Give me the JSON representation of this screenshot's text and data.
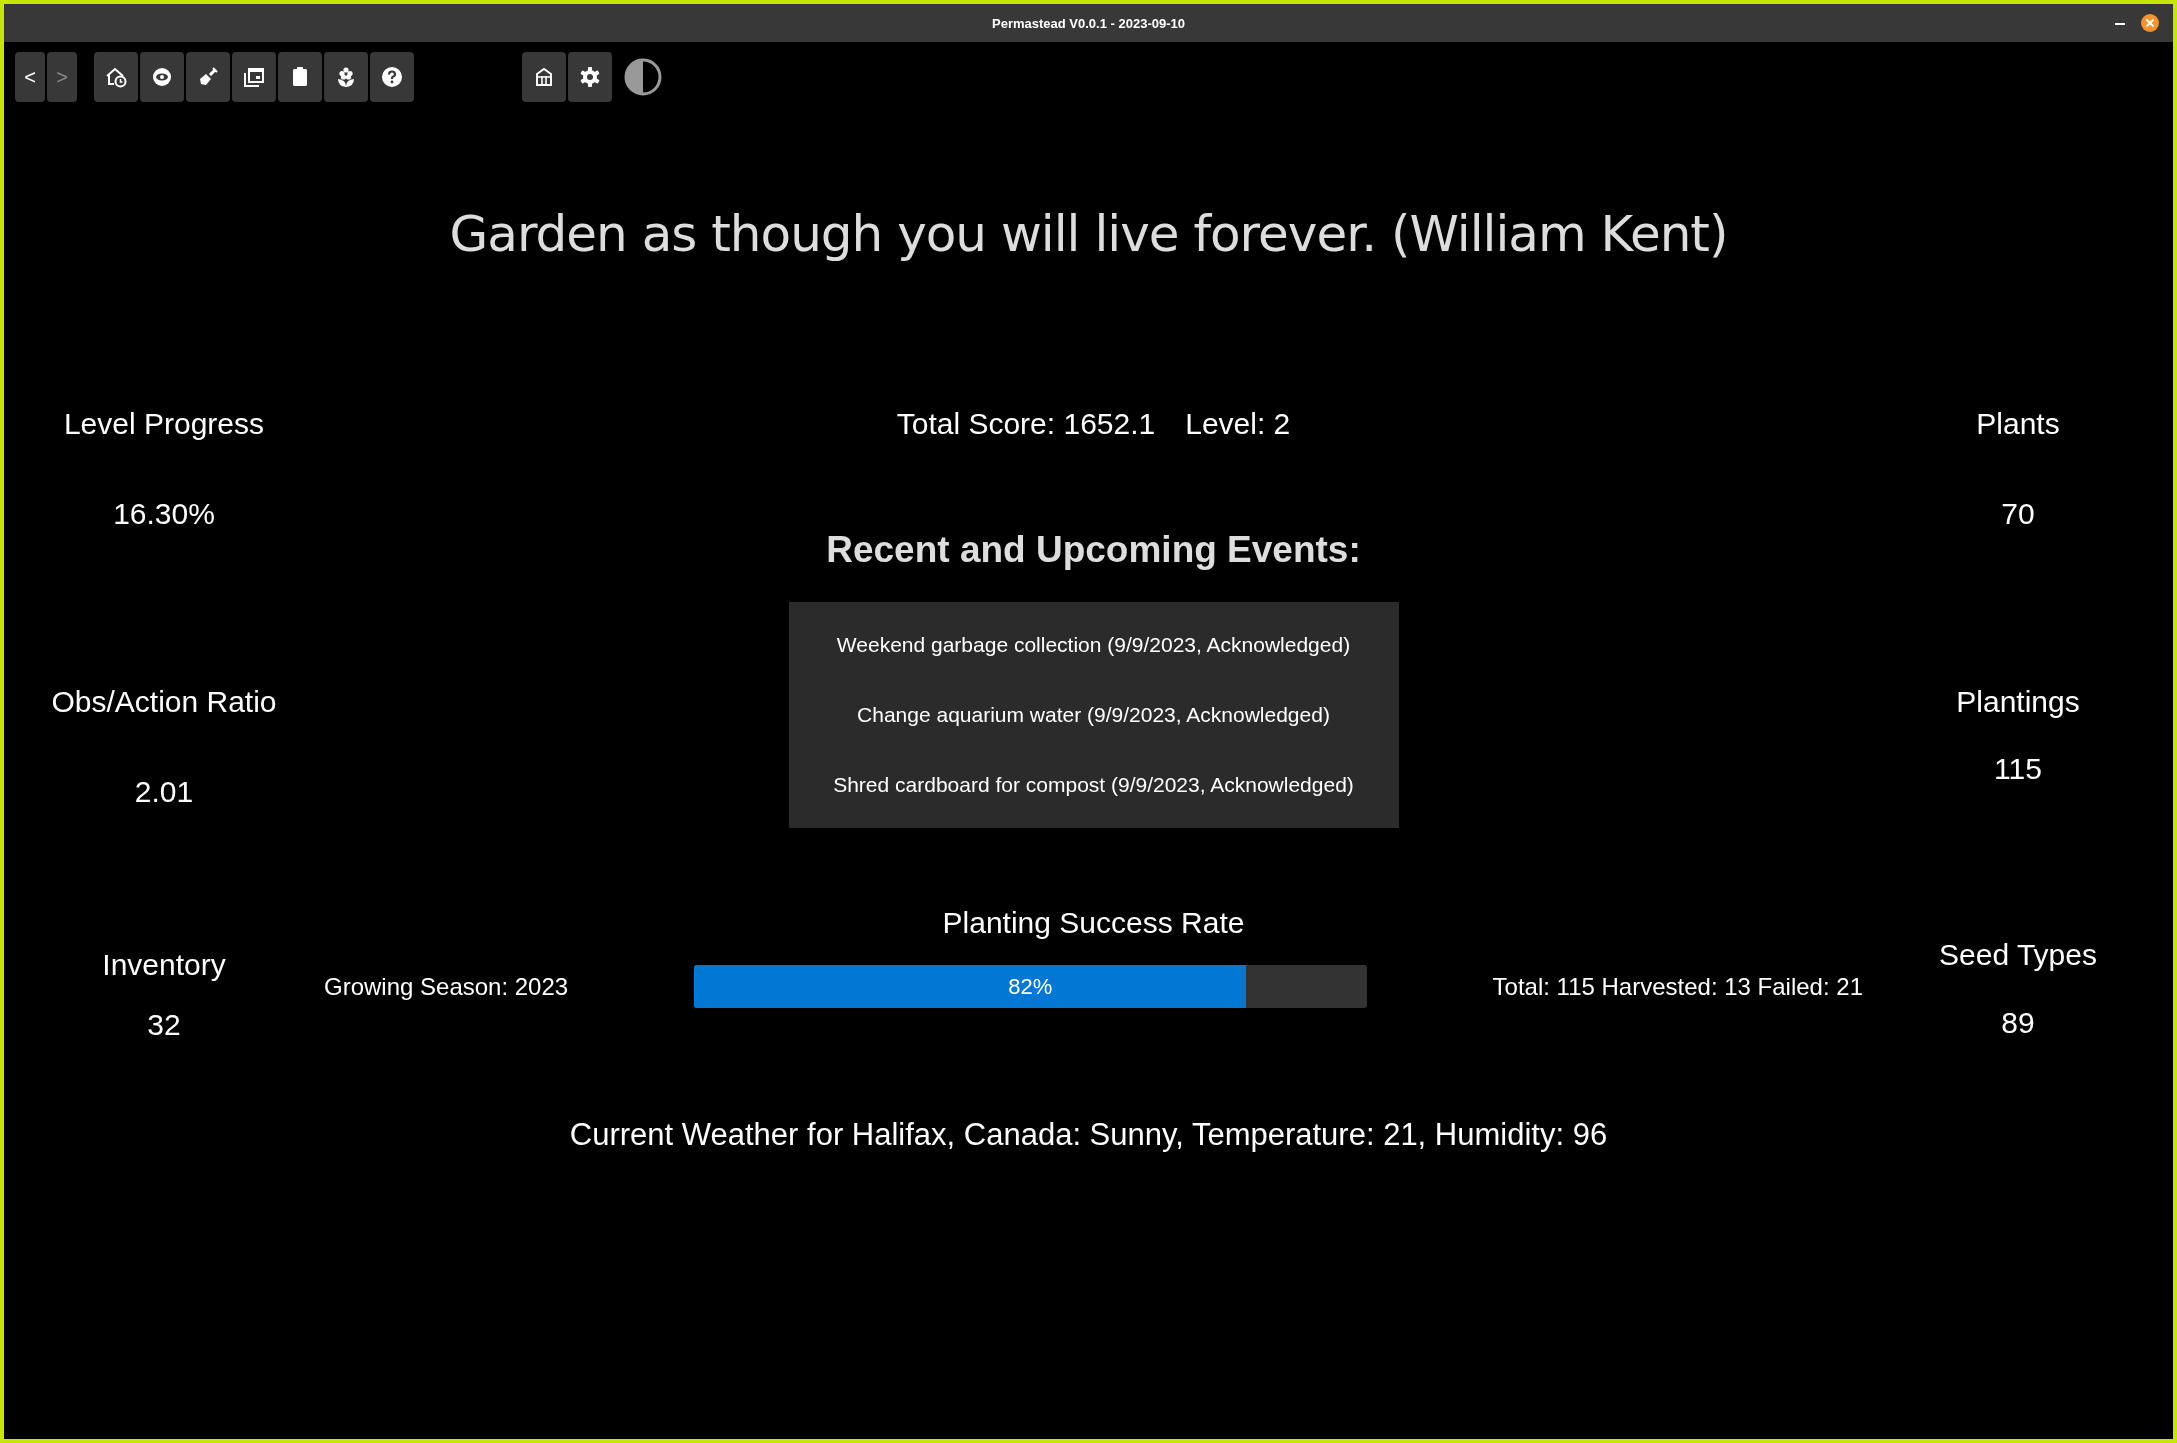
{
  "window": {
    "title": "Permastead V0.0.1 - 2023-09-10"
  },
  "toolbar": {
    "nav": [
      {
        "label": "<",
        "disabled": false
      },
      {
        "label": ">",
        "disabled": true
      }
    ]
  },
  "quote": "Garden as though you will live forever. (William Kent)",
  "left_stats": [
    {
      "label": "Level Progress",
      "value": "16.30%"
    },
    {
      "label": "Obs/Action Ratio",
      "value": "2.01"
    },
    {
      "label": "Inventory",
      "value": "32"
    }
  ],
  "score": {
    "total": "Total Score: 1652.1",
    "level": "Level: 2"
  },
  "events": {
    "heading": "Recent and Upcoming Events:",
    "items": [
      "Weekend garbage collection (9/9/2023, Acknowledged)",
      "Change aquarium water (9/9/2023, Acknowledged)",
      "Shred cardboard for compost (9/9/2023, Acknowledged)"
    ]
  },
  "planting": {
    "title": "Planting Success Rate",
    "season": "Growing Season: 2023",
    "level": 0.82,
    "label": "82%",
    "totals": "Total: 115 Harvested: 13 Failed: 21"
  },
  "right_stats": [
    {
      "label": "Plants",
      "value": "70"
    },
    {
      "label": "Plantings",
      "value": "115"
    },
    {
      "label": "Seed Types",
      "value": "89"
    }
  ],
  "weather": "Current Weather for Halifax, Canada: Sunny, Temperature: 21, Humidity: 96"
}
